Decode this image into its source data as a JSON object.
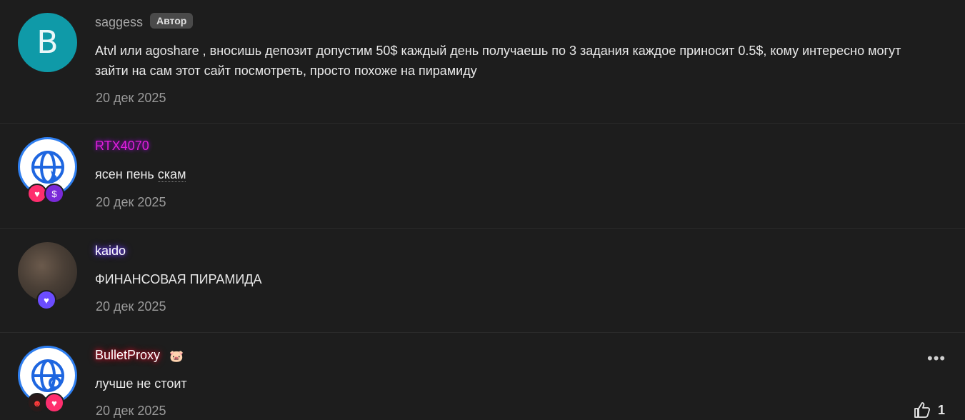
{
  "comments": [
    {
      "username": "saggess",
      "author_badge": "Автор",
      "avatar_letter": "B",
      "text": "Atvl или agoshare , вносишь депозит допустим 50$ каждый день получаешь по 3 задания каждое приносит 0.5$, кому интересно могут зайти на сам этот сайт посмотреть, просто похоже на пирамиду",
      "date": "20 дек 2025"
    },
    {
      "username": "RTX4070",
      "text_main": "ясен пень ",
      "text_link": "скам",
      "date": "20 дек 2025",
      "username_color": "#e01fd8"
    },
    {
      "username": "kaido",
      "text": "ФИНАНСОВАЯ ПИРАМИДА",
      "date": "20 дек 2025",
      "username_glow": "#6a3cff"
    },
    {
      "username": "BulletProxy",
      "text": "лучше не стоит",
      "date": "20 дек 2025",
      "likes": "1",
      "username_glow": "#d0102a"
    }
  ],
  "icons": {
    "more": "more-icon",
    "like": "thumbs-up-icon",
    "heart": "heart-icon",
    "dollar": "dollar-icon"
  }
}
